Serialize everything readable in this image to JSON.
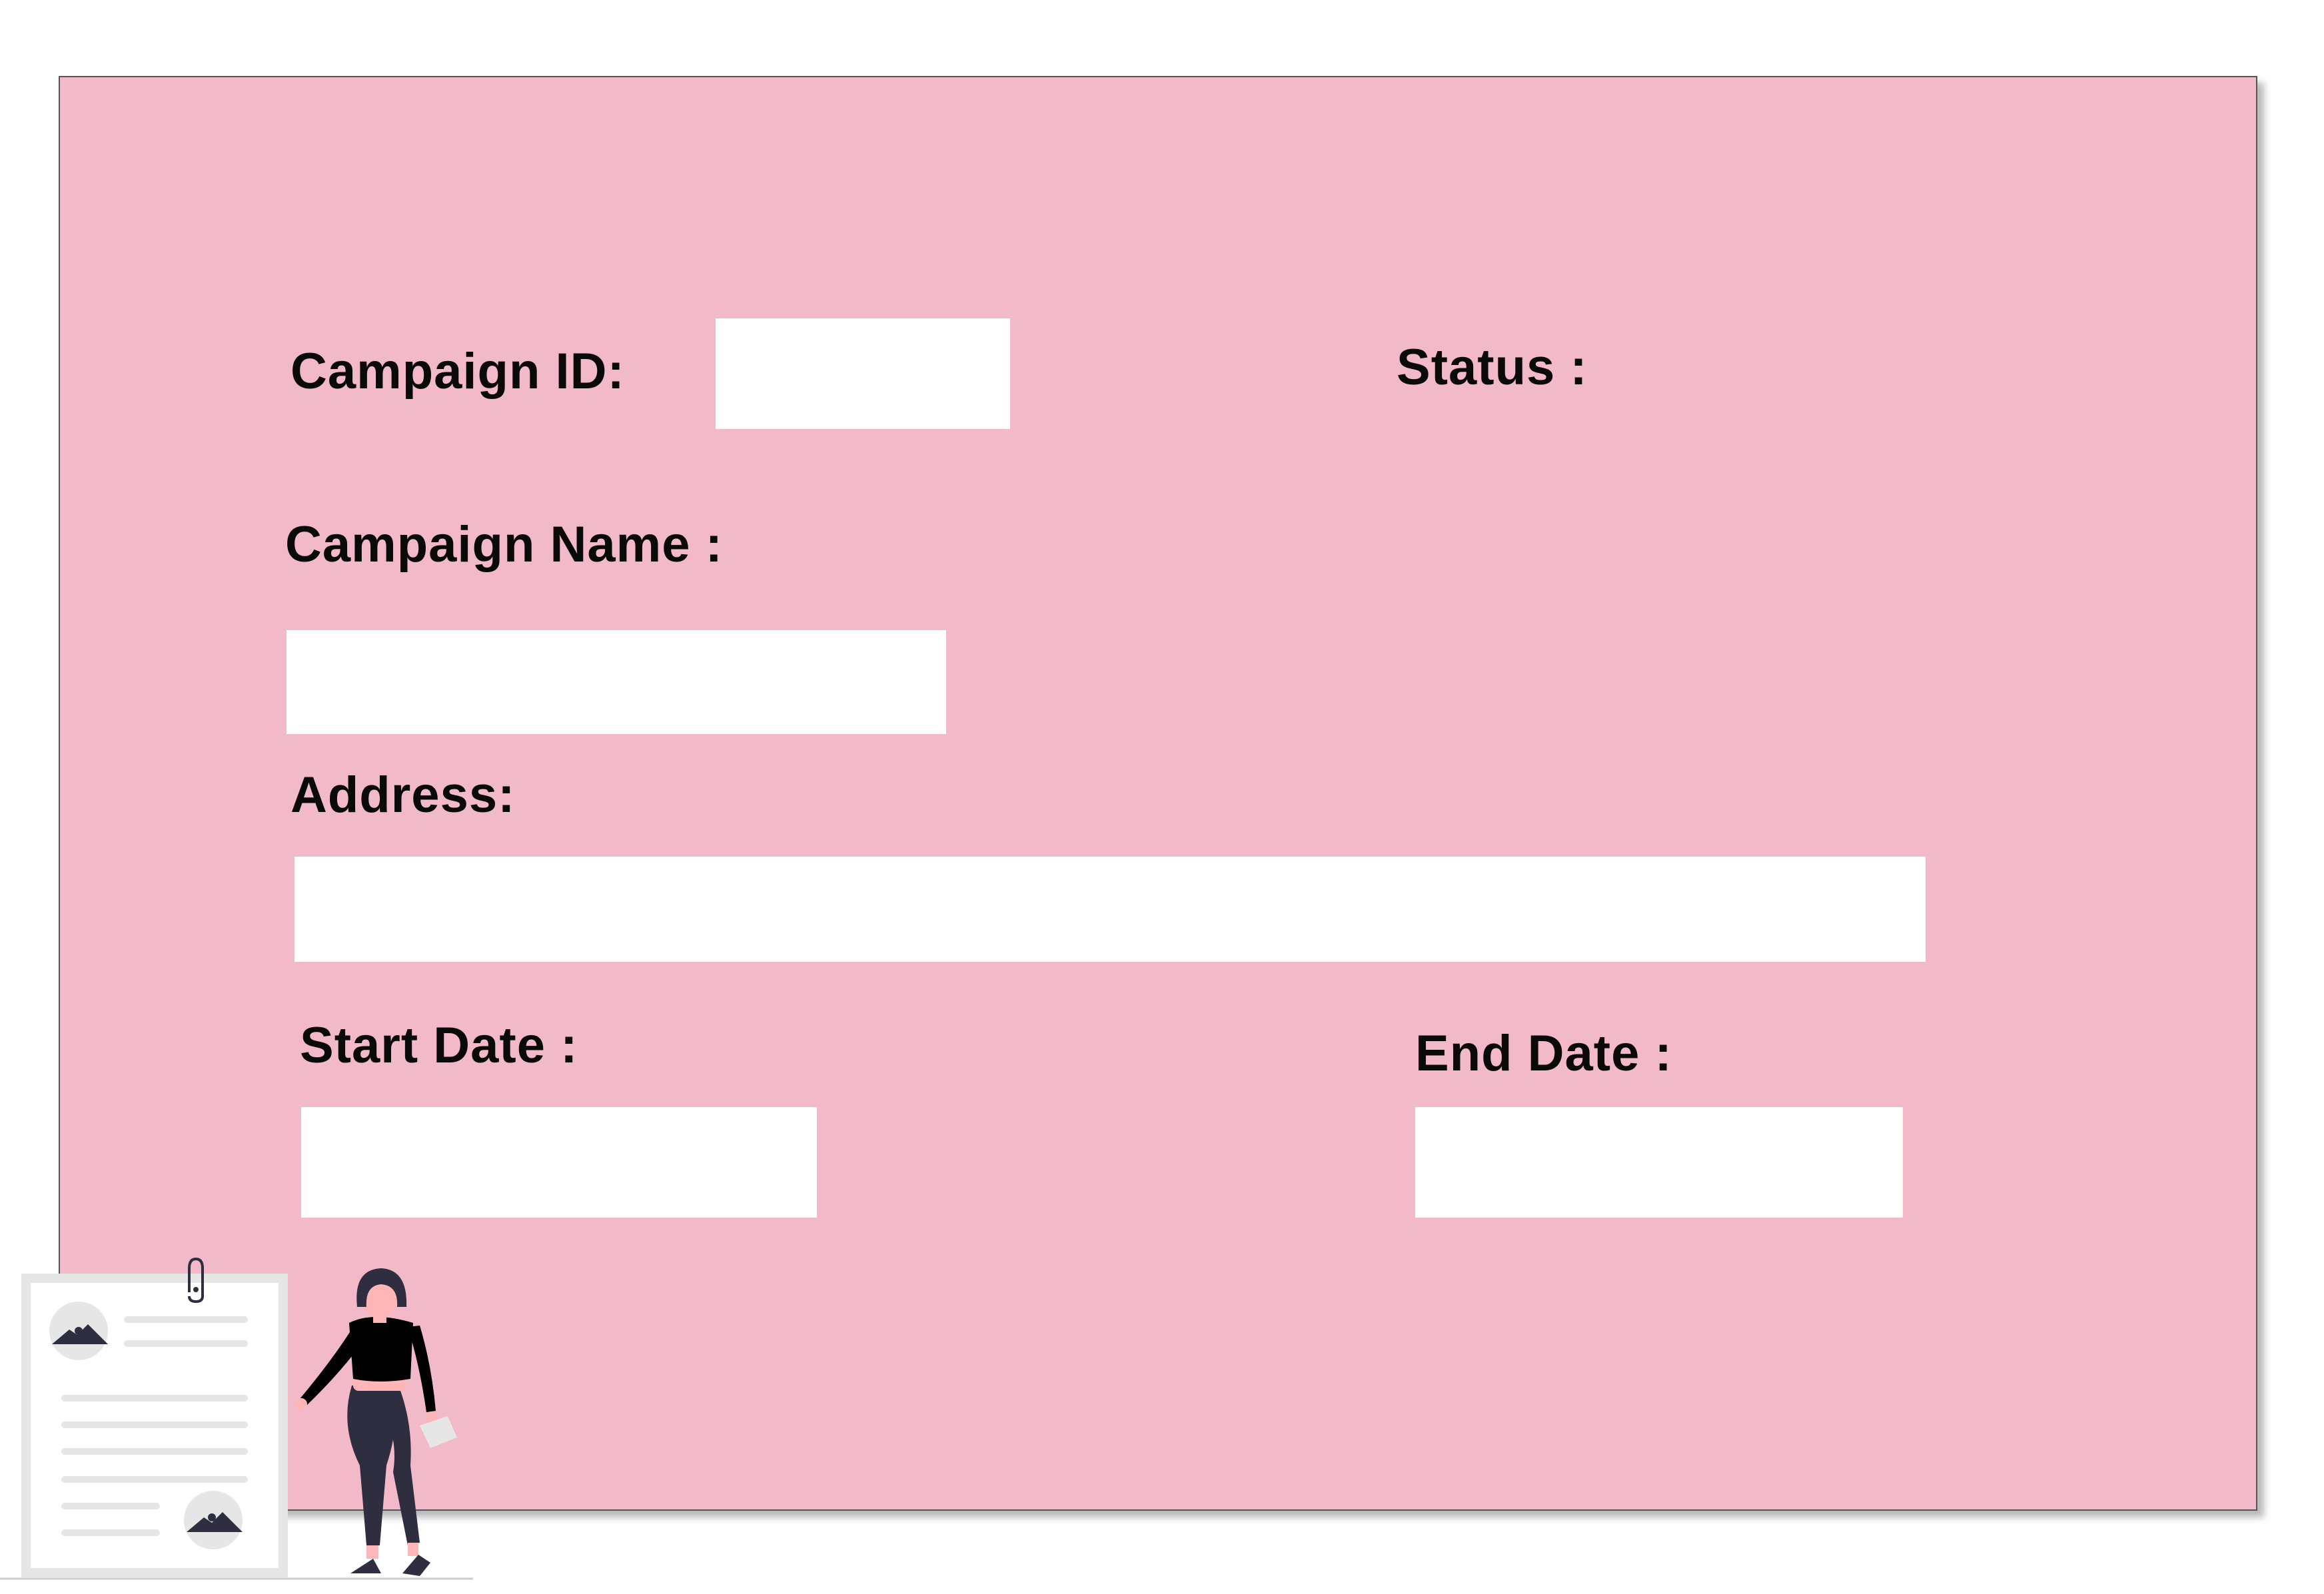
{
  "form": {
    "campaign_id_label": "Campaign ID:",
    "campaign_id_value": "",
    "status_label": "Status :",
    "campaign_name_label": "Campaign Name :",
    "campaign_name_value": "",
    "address_label": "Address:",
    "address_value": "",
    "start_date_label": "Start Date :",
    "start_date_value": "",
    "end_date_label": "End Date :",
    "end_date_value": ""
  },
  "colors": {
    "panel_background": "#f2b9c8",
    "field_background": "#ffffff",
    "label_text": "#0a0a0a",
    "illustration_dark": "#2f2e41",
    "illustration_light": "#e6e6e6",
    "illustration_skin": "#ffb6b6"
  },
  "icons": {
    "paperclip": "paperclip-icon",
    "image_placeholder": "image-icon",
    "person": "person-illustration"
  }
}
